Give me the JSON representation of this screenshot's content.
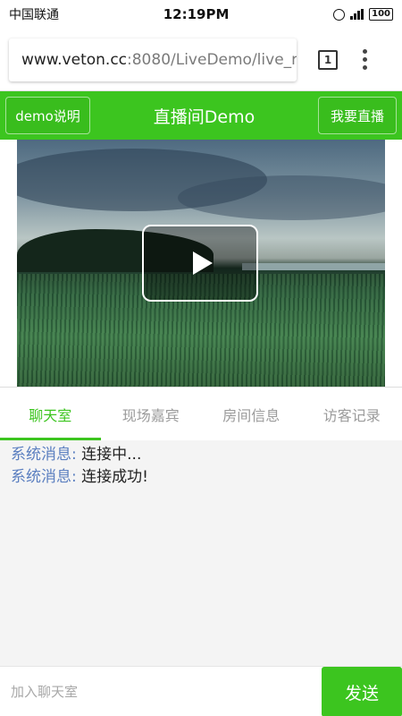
{
  "status_bar": {
    "carrier": "中国联通",
    "time": "12:19PM",
    "battery": "100"
  },
  "browser": {
    "url_host": "www.veton.cc",
    "url_path": ":8080/LiveDemo/live_r",
    "tab_count": "1"
  },
  "header": {
    "left_button": "demo说明",
    "title": "直播间Demo",
    "right_button": "我要直播"
  },
  "tabs": [
    {
      "label": "聊天室",
      "active": true
    },
    {
      "label": "现场嘉宾",
      "active": false
    },
    {
      "label": "房间信息",
      "active": false
    },
    {
      "label": "访客记录",
      "active": false
    }
  ],
  "messages": [
    {
      "sender": "系统消息:",
      "text": " 连接中..."
    },
    {
      "sender": "系统消息:",
      "text": " 连接成功!"
    }
  ],
  "input": {
    "placeholder": "加入聊天室",
    "send_label": "发送"
  },
  "colors": {
    "accent": "#3cc51f",
    "sender": "#5b7fc0"
  },
  "icons": [
    "alarm-icon",
    "signal-icon",
    "battery-icon",
    "tab-switcher-icon",
    "overflow-menu-icon",
    "play-icon"
  ]
}
